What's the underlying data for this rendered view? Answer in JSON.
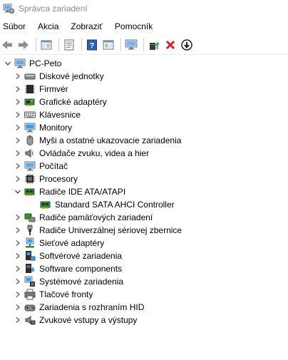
{
  "window": {
    "title": "Správca zariadení"
  },
  "menu": [
    "Súbor",
    "Akcia",
    "Zobraziť",
    "Pomocník"
  ],
  "toolbar": {
    "buttons": [
      "back-icon",
      "forward-icon",
      "console-tree-icon",
      "properties-icon",
      "help-icon",
      "action-pane-icon",
      "monitor-icon",
      "update-driver-icon",
      "uninstall-icon",
      "disable-icon"
    ]
  },
  "tree": {
    "root": "PC-Peto",
    "items": [
      {
        "label": "Diskové jednotky",
        "icon": "disk-drive-icon",
        "expanded": false
      },
      {
        "label": "Firmvér",
        "icon": "firmware-icon",
        "expanded": false
      },
      {
        "label": "Grafické adaptéry",
        "icon": "display-adapter-icon",
        "expanded": false
      },
      {
        "label": "Klávesnice",
        "icon": "keyboard-icon",
        "expanded": false
      },
      {
        "label": "Monitory",
        "icon": "monitor-icon",
        "expanded": false
      },
      {
        "label": "Myši a ostatné ukazovacie zariadenia",
        "icon": "mouse-icon",
        "expanded": false
      },
      {
        "label": "Ovládače zvuku, videa a hier",
        "icon": "speaker-icon",
        "expanded": false
      },
      {
        "label": "Počítač",
        "icon": "computer-icon",
        "expanded": false
      },
      {
        "label": "Procesory",
        "icon": "processor-icon",
        "expanded": false
      },
      {
        "label": "Radiče IDE ATA/ATAPI",
        "icon": "ide-controller-icon",
        "expanded": true,
        "children": [
          {
            "label": "Standard SATA AHCI Controller",
            "icon": "ide-controller-icon"
          }
        ]
      },
      {
        "label": "Radiče pamäťových zariadení",
        "icon": "storage-controller-icon",
        "expanded": false
      },
      {
        "label": "Radiče Univerzálnej sériovej zbernice",
        "icon": "usb-icon",
        "expanded": false
      },
      {
        "label": "Sieťové adaptéry",
        "icon": "network-adapter-icon",
        "expanded": false
      },
      {
        "label": "Softvérové zariadenia",
        "icon": "software-device-icon",
        "expanded": false
      },
      {
        "label": "Software components",
        "icon": "software-component-icon",
        "expanded": false
      },
      {
        "label": "Systémové zariadenia",
        "icon": "system-device-icon",
        "expanded": false
      },
      {
        "label": "Tlačové fronty",
        "icon": "printer-icon",
        "expanded": false
      },
      {
        "label": "Zariadenia s rozhraním HID",
        "icon": "hid-icon",
        "expanded": false
      },
      {
        "label": "Zvukové vstupy a výstupy",
        "icon": "audio-io-icon",
        "expanded": false
      }
    ]
  }
}
